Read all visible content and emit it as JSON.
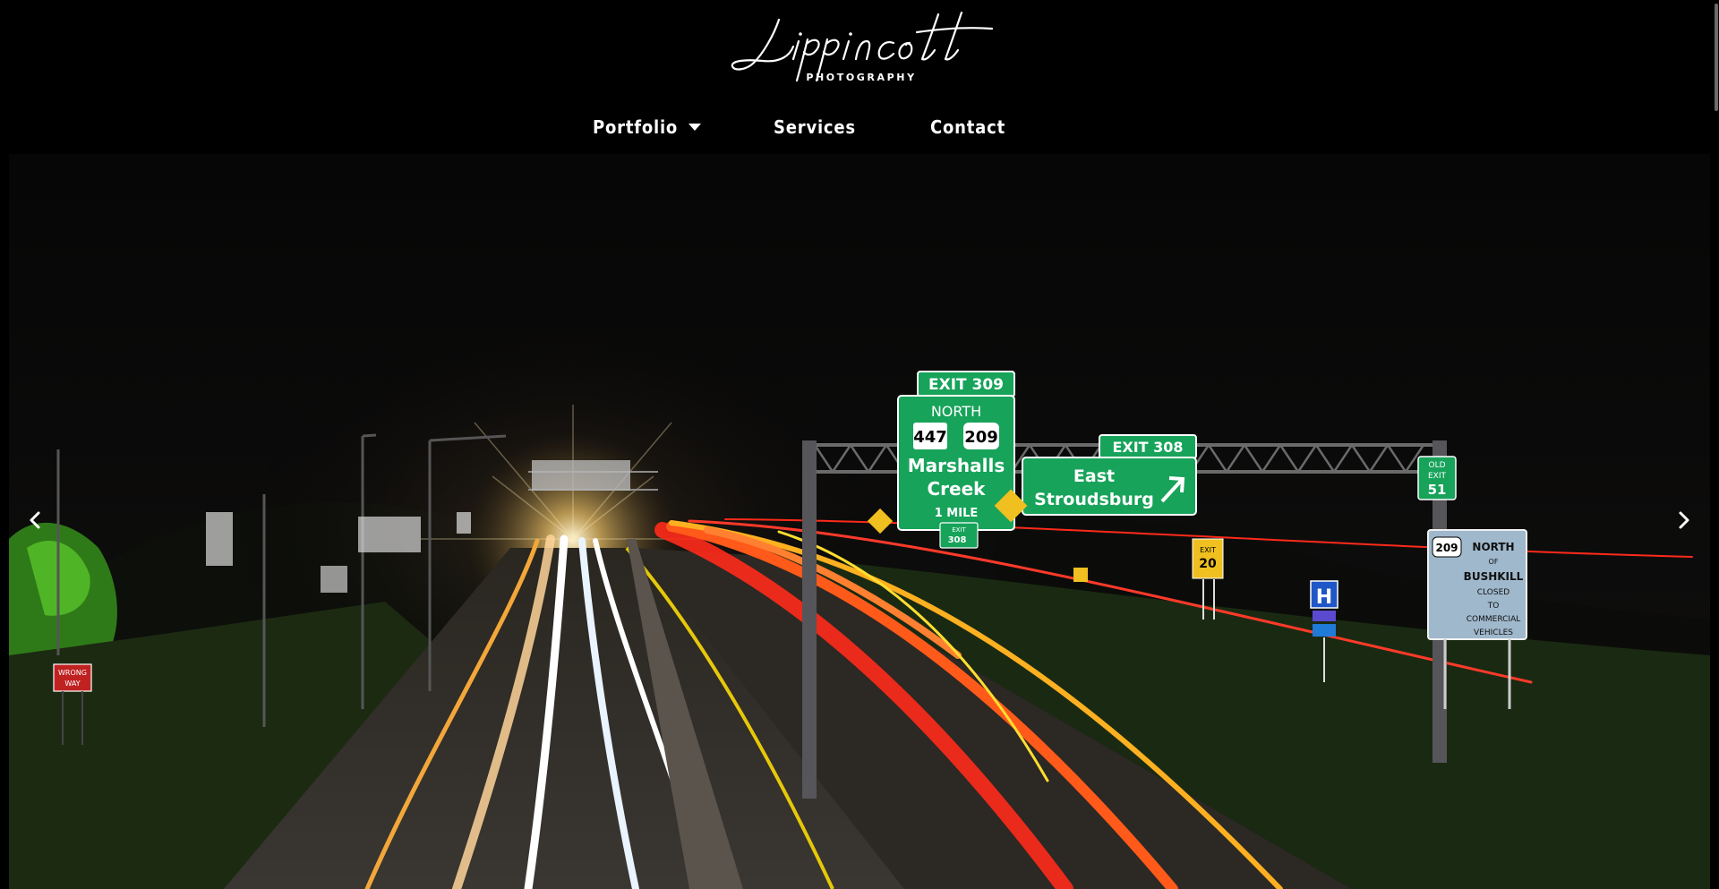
{
  "header": {
    "logo_script": "Lippincott",
    "logo_subtitle": "PHOTOGRAPHY"
  },
  "nav": {
    "items": [
      {
        "label": "Portfolio",
        "has_dropdown": true
      },
      {
        "label": "Services"
      },
      {
        "label": "Contact"
      }
    ]
  },
  "slider": {
    "prev_icon": "chevron-left-icon",
    "next_icon": "chevron-right-icon",
    "signs": {
      "exit309_tab": "EXIT  309",
      "north": "NORTH",
      "route447": "447",
      "route209": "209",
      "marshalls": "Marshalls",
      "creek": "Creek",
      "mile": "1  MILE",
      "exit308_tab": "EXIT  308",
      "east": "East",
      "stroudsburg": "Stroudsburg",
      "old_exit_1": "OLD",
      "old_exit_2": "EXIT",
      "old_exit_3": "51",
      "bushkill_route": "209",
      "bushkill_1": "NORTH",
      "bushkill_2": "OF",
      "bushkill_3": "BUSHKILL",
      "bushkill_4": "CLOSED",
      "bushkill_5": "TO",
      "bushkill_6": "COMMERCIAL",
      "bushkill_7": "VEHICLES",
      "small_exit_1": "EXIT",
      "small_exit_2": "308",
      "yellow_exit_1": "EXIT",
      "yellow_exit_2": "20",
      "wrong_way_1": "WRONG",
      "wrong_way_2": "WAY",
      "hospital": "H"
    }
  },
  "colors": {
    "background": "#000000",
    "nav_text": "#ffffff",
    "sign_green": "#17a35a",
    "light_trail_red": "#ff2a1a"
  }
}
